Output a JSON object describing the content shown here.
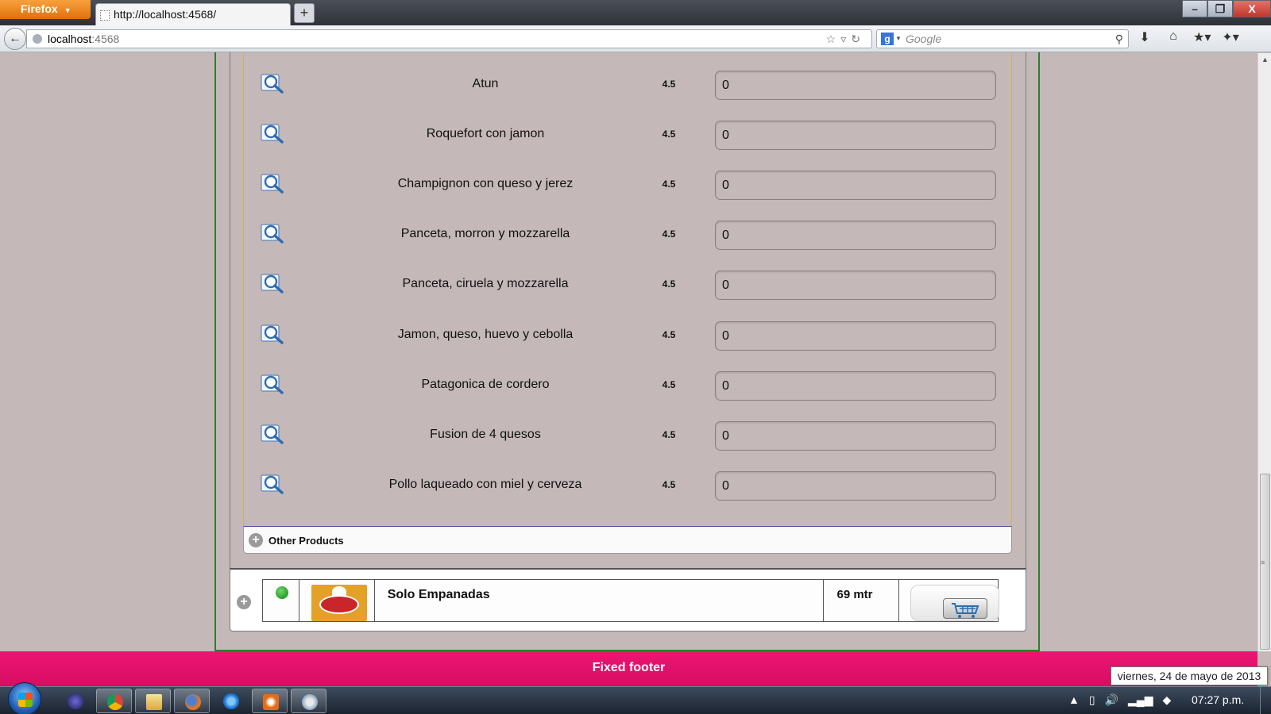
{
  "browser": {
    "menu_label": "Firefox",
    "tab_title": "http://localhost:4568/",
    "new_tab": "+",
    "url_host": "localhost",
    "url_port": ":4568",
    "search_placeholder": "Google",
    "window_buttons": [
      "–",
      "❐",
      "X"
    ]
  },
  "products": [
    {
      "name": "Atun",
      "price": "4.5",
      "qty": "0"
    },
    {
      "name": "Roquefort con jamon",
      "price": "4.5",
      "qty": "0"
    },
    {
      "name": "Champignon con queso y jerez",
      "price": "4.5",
      "qty": "0"
    },
    {
      "name": "Panceta, morron y mozzarella",
      "price": "4.5",
      "qty": "0"
    },
    {
      "name": "Panceta, ciruela y mozzarella",
      "price": "4.5",
      "qty": "0"
    },
    {
      "name": "Jamon, queso, huevo y cebolla",
      "price": "4.5",
      "qty": "0"
    },
    {
      "name": "Patagonica de cordero",
      "price": "4.5",
      "qty": "0"
    },
    {
      "name": "Fusion de 4 quesos",
      "price": "4.5",
      "qty": "0"
    },
    {
      "name": "Pollo laqueado con miel y cerveza",
      "price": "4.5",
      "qty": "0"
    }
  ],
  "other_products": {
    "label": "Other Products"
  },
  "store": {
    "name": "Solo Empanadas",
    "distance": "69 mtr",
    "status_color": "#0a8a0a",
    "logo_text": "Solo Empanadas"
  },
  "footer": {
    "text": "Fixed footer",
    "color": "#e8116b"
  },
  "tooltip": {
    "text": "viernes, 24 de mayo de 2013"
  },
  "taskbar": {
    "clock": "07:27 p.m.",
    "apps": [
      "eclipse-icon",
      "chrome-icon",
      "explorer-icon",
      "firefox-icon",
      "ie-icon",
      "settings-app-icon",
      "paint-icon"
    ]
  }
}
